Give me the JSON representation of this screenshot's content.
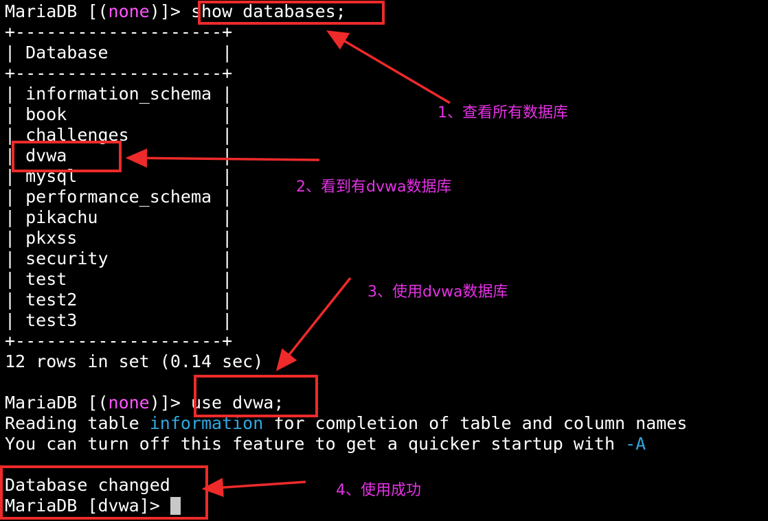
{
  "terminal": {
    "prompt1": {
      "pre": "MariaDB [(",
      "db": "none",
      "post": ")]> ",
      "command": "show databases;"
    },
    "table": {
      "border": "+--------------------+",
      "header": "| Database           |",
      "rows": [
        "| information_schema |",
        "| book               |",
        "| challenges         |",
        "| dvwa               |",
        "| mysql              |",
        "| performance_schema |",
        "| pikachu            |",
        "| pkxss              |",
        "| security           |",
        "| test               |",
        "| test2              |",
        "| test3              |"
      ]
    },
    "result": "12 rows in set (0.14 sec)",
    "prompt2": {
      "pre": "MariaDB [(",
      "db": "none",
      "post": ")]> ",
      "command": "use dvwa;"
    },
    "reading": {
      "pre": "Reading table ",
      "highlight": "information",
      "post": " for completion of table and column names"
    },
    "hint": {
      "pre": "You can turn off this feature to get a quicker startup with ",
      "flag": "-A"
    },
    "changed": "Database changed",
    "prompt3": "MariaDB [dvwa]> "
  },
  "annotations": [
    "1、查看所有数据库",
    "2、看到有dvwa数据库",
    "3、使用dvwa数据库",
    "4、使用成功"
  ],
  "colors": {
    "background": "#000000",
    "text": "#ffffff",
    "prompt_db": "#ff55ff",
    "keyword": "#2fa8e0",
    "annotation": "#e632e6",
    "highlight_box": "#ee2a2a"
  }
}
